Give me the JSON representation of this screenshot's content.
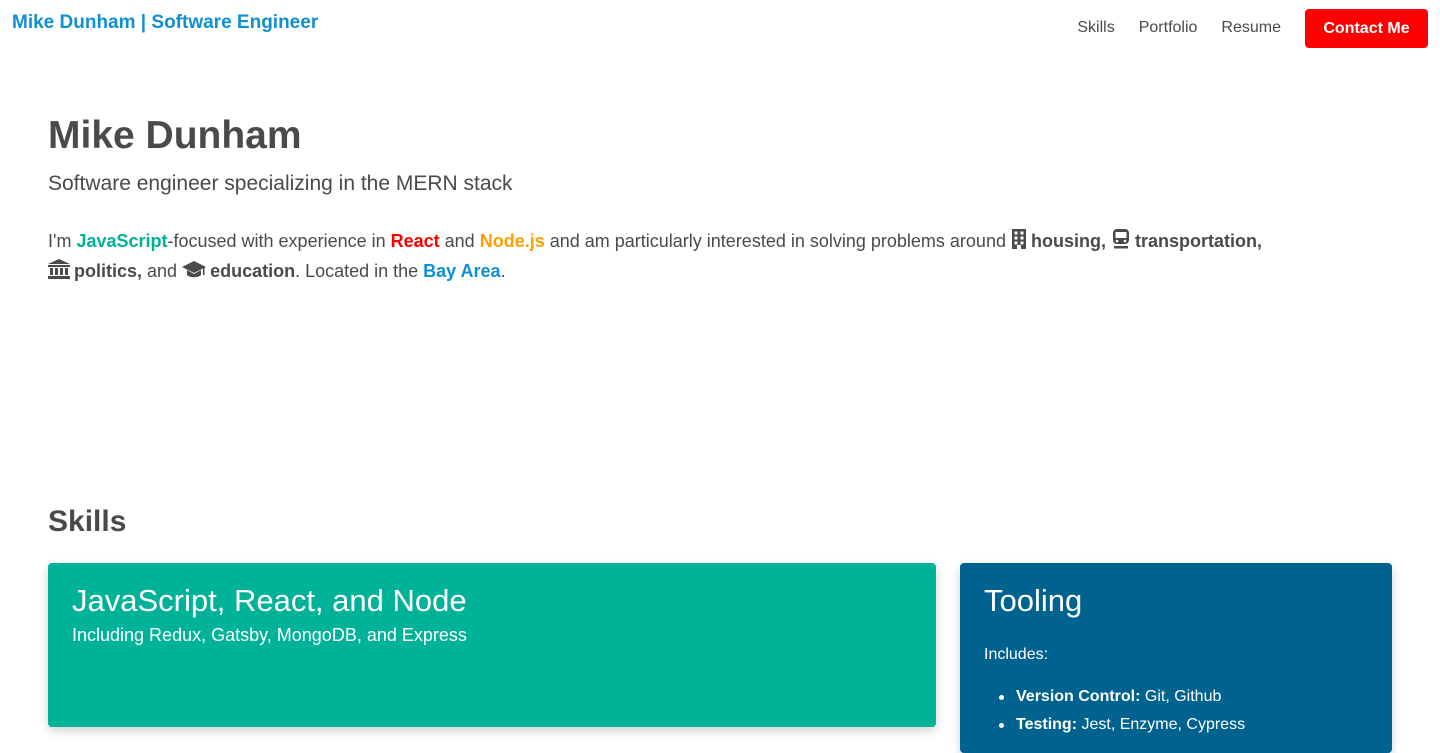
{
  "nav": {
    "brand": "Mike Dunham | Software Engineer",
    "links": [
      "Skills",
      "Portfolio",
      "Resume"
    ],
    "contact_label": "Contact Me"
  },
  "hero": {
    "name": "Mike Dunham",
    "subtitle": "Software engineer specializing in the MERN stack",
    "bio": {
      "t1": "I'm ",
      "js": "JavaScript",
      "t2": "-focused with experience in ",
      "react": "React",
      "t3": " and ",
      "node": "Node.js",
      "t4": " and am particularly interested in solving problems around ",
      "housing": "housing,",
      "transportation": "transportation,",
      "politics": "politics,",
      "t5": " and ",
      "education": "education",
      "t6": ". Located in the ",
      "bay": "Bay Area",
      "t7": "."
    },
    "icons": [
      "building-icon",
      "train-icon",
      "landmark-icon",
      "graduation-cap-icon"
    ]
  },
  "skills": {
    "title": "Skills",
    "cards": [
      {
        "title": "JavaScript, React, and Node",
        "subtitle": "Including Redux, Gatsby, MongoDB, and Express"
      },
      {
        "title": "Tooling",
        "includes": "Includes:",
        "items": [
          {
            "label": "Version Control:",
            "value": " Git, Github"
          },
          {
            "label": "Testing:",
            "value": " Jest, Enzyme, Cypress"
          }
        ]
      }
    ]
  },
  "colors": {
    "brand": "#0f8fd4",
    "contact_button": "#ff0000",
    "javascript": "#00b097",
    "react": "#ff0000",
    "node": "#ff9f00",
    "card_green": "#00b298",
    "card_blue": "#00628f"
  }
}
